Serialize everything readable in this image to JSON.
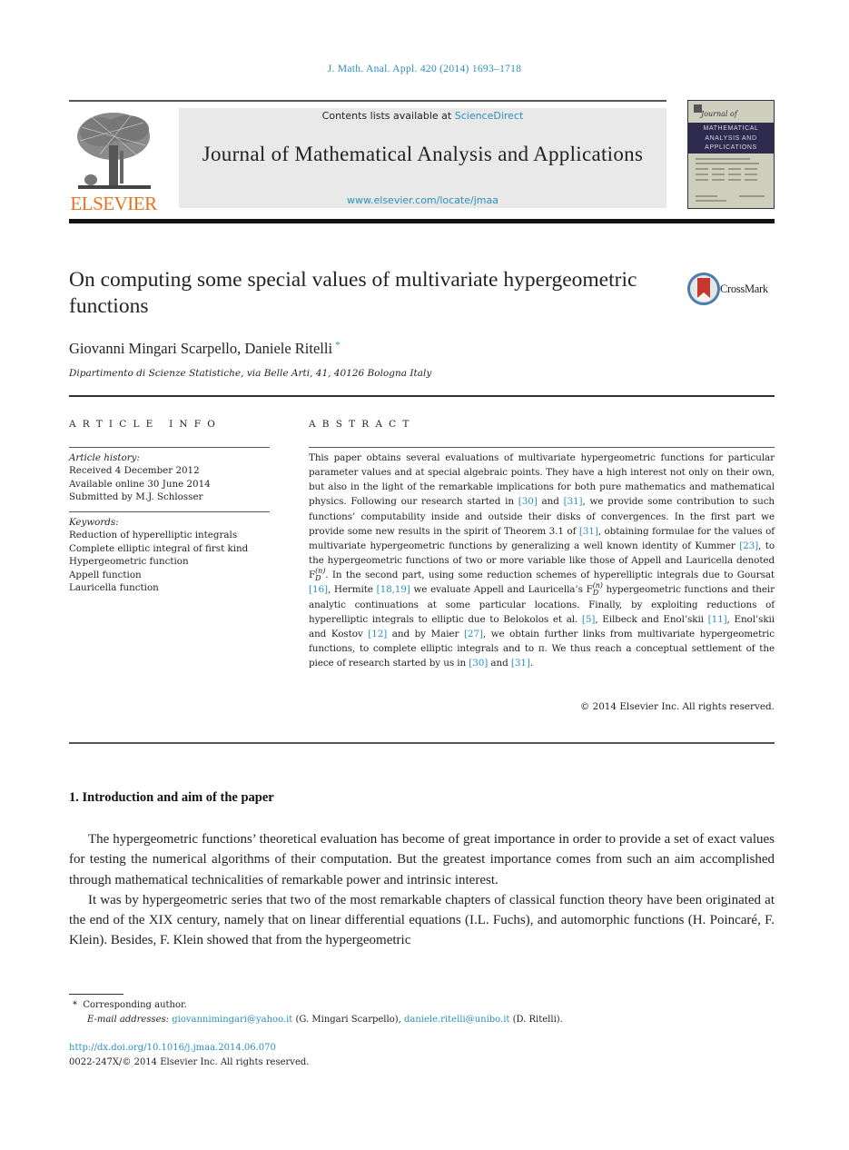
{
  "running_head": "J. Math. Anal. Appl. 420 (2014) 1693–1718",
  "masthead": {
    "publisher": "ELSEVIER",
    "contents_prefix": "Contents lists available at ",
    "contents_link": "ScienceDirect",
    "journal_title": "Journal of Mathematical Analysis and Applications",
    "journal_url": "www.elsevier.com/locate/jmaa",
    "cover": {
      "script_title": "Journal of",
      "band_lines": [
        "MATHEMATICAL",
        "ANALYSIS AND",
        "APPLICATIONS"
      ]
    }
  },
  "article": {
    "title": "On computing some special values of multivariate hypergeometric functions",
    "crossmark_label": "CrossMark",
    "authors": "Giovanni Mingari Scarpello, Daniele Ritelli",
    "corresponding_marker": "*",
    "affiliation": "Dipartimento di Scienze Statistiche, via Belle Arti, 41, 40126 Bologna Italy"
  },
  "article_info": {
    "heading": "ARTICLE INFO",
    "history_label": "Article history:",
    "history": [
      "Received 4 December 2012",
      "Available online 30 June 2014",
      "Submitted by M.J. Schlosser"
    ],
    "keywords_label": "Keywords:",
    "keywords": [
      "Reduction of hyperelliptic integrals",
      "Complete elliptic integral of first kind",
      "Hypergeometric function",
      "Appell function",
      "Lauricella function"
    ]
  },
  "abstract": {
    "heading": "ABSTRACT",
    "segments": {
      "s1": "This paper obtains several evaluations of multivariate hypergeometric functions for particular parameter values and at special algebraic points. They have a high interest not only on their own, but also in the light of the remarkable implications for both pure mathematics and mathematical physics. Following our research started in ",
      "r30a": "[30]",
      "s2": " and ",
      "r31a": "[31]",
      "s3": ", we provide some contribution to such functions’ computability inside and outside their disks of convergences. In the first part we provide some new results in the spirit of Theorem 3.1 of ",
      "r31b": "[31]",
      "s4": ", obtaining formulae for the values of multivariate hypergeometric functions by generalizing a well known identity of Kummer ",
      "r23": "[23]",
      "s5": ", to the hypergeometric functions of two or more variable like those of Appell and Lauricella denoted ",
      "fd_base": "F",
      "fd_sup": "(n)",
      "fd_sub": "D",
      "s6": ". In the second part, using some reduction schemes of hyperelliptic integrals due to Goursat ",
      "r16": "[16]",
      "s7": ", Hermite ",
      "r18_19": "[18,19]",
      "s8": " we evaluate Appell and Lauricella’s ",
      "s9": " hypergeometric functions and their analytic continuations at some particular locations. Finally, by exploiting reductions of hyperelliptic integrals to elliptic due to Belokolos et al. ",
      "r5": "[5]",
      "s10": ", Eilbeck and Enol’skii ",
      "r11": "[11]",
      "s11": ", Enol’skii and Kostov ",
      "r12": "[12]",
      "s12": " and by Maier ",
      "r27": "[27]",
      "s13": ", we obtain further links from multivariate hypergeometric functions, to complete elliptic integrals and to π. We thus reach a conceptual settlement of the piece of research started by us in ",
      "r30b": "[30]",
      "s14": " and ",
      "r31c": "[31]",
      "s15": "."
    },
    "copyright": "© 2014 Elsevier Inc. All rights reserved."
  },
  "section": {
    "heading": "1.  Introduction and aim of the paper",
    "paragraphs": [
      "The hypergeometric functions’ theoretical evaluation has become of great importance in order to provide a set of exact values for testing the numerical algorithms of their computation. But the greatest importance comes from such an aim accomplished through mathematical technicalities of remarkable power and intrinsic interest.",
      "It was by hypergeometric series that two of the most remarkable chapters of classical function theory have been originated at the end of the XIX century, namely that on linear differential equations (I.L. Fuchs), and automorphic functions (H. Poincaré, F. Klein). Besides, F. Klein showed that from the hypergeometric"
    ]
  },
  "footnotes": {
    "marker": "*",
    "corresponding": "Corresponding author.",
    "email_label": "E-mail addresses:",
    "email1": "giovannimingari@yahoo.it",
    "email1_owner": " (G. Mingari Scarpello), ",
    "email2": "daniele.ritelli@unibo.it",
    "email2_owner": " (D. Ritelli)."
  },
  "doi": {
    "url": "http://dx.doi.org/10.1016/j.jmaa.2014.06.070",
    "issn_line": "0022-247X/© 2014 Elsevier Inc. All rights reserved."
  },
  "colors": {
    "link": "#2a8fbd",
    "elsevier_orange": "#e9711c",
    "masthead_bg": "#e9e9e9",
    "cover_band": "#2e2b4f"
  }
}
